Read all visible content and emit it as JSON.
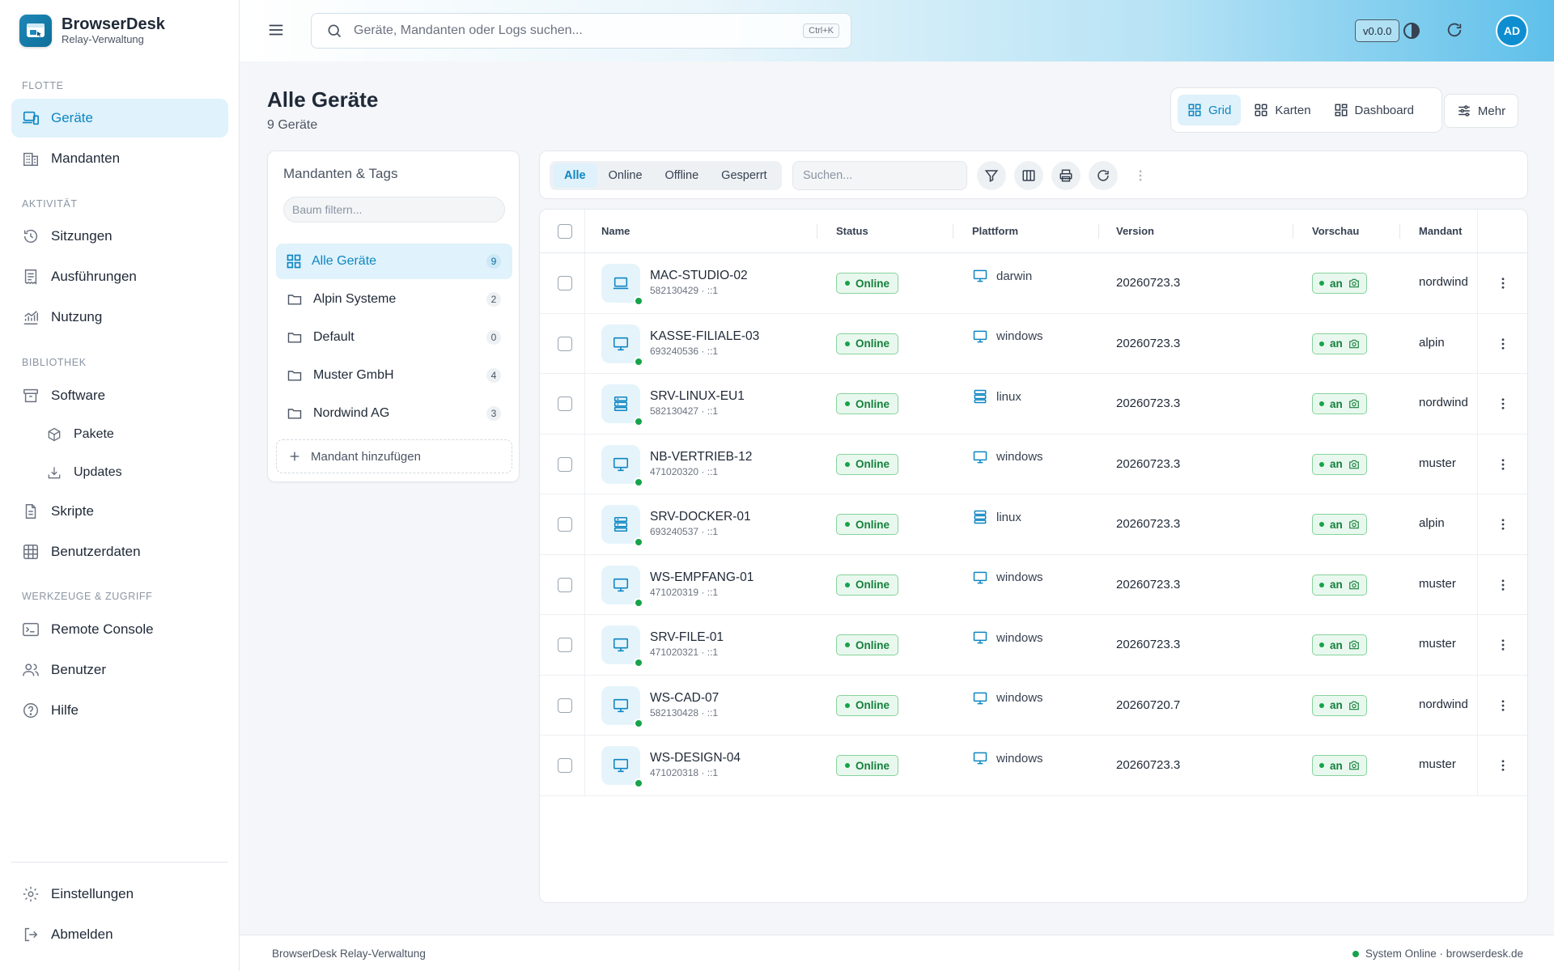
{
  "brand": {
    "title": "BrowserDesk",
    "subtitle": "Relay-Verwaltung"
  },
  "sidebar": {
    "sections": [
      "Flotte",
      "Aktivität",
      "Bibliothek",
      "Werkzeuge & Zugriff"
    ],
    "items": [
      {
        "label": "Geräte",
        "icon": "devices-icon",
        "active": true
      },
      {
        "label": "Mandanten",
        "icon": "building-icon"
      },
      {
        "label": "Sitzungen",
        "icon": "history-icon"
      },
      {
        "label": "Ausführungen",
        "icon": "receipt-icon"
      },
      {
        "label": "Nutzung",
        "icon": "chart-icon"
      },
      {
        "label": "Software",
        "icon": "archive-icon"
      },
      {
        "label": "Pakete",
        "icon": "package-icon"
      },
      {
        "label": "Updates",
        "icon": "download-icon"
      },
      {
        "label": "Skripte",
        "icon": "file-icon"
      },
      {
        "label": "Benutzerdaten",
        "icon": "grid-icon"
      },
      {
        "label": "Remote Console",
        "icon": "terminal-icon"
      },
      {
        "label": "Benutzer",
        "icon": "users-icon"
      },
      {
        "label": "Hilfe",
        "icon": "help-icon"
      }
    ],
    "bottom": [
      {
        "label": "Einstellungen",
        "icon": "gear-icon"
      },
      {
        "label": "Abmelden",
        "icon": "logout-icon"
      }
    ]
  },
  "header": {
    "search_placeholder": "Geräte, Mandanten oder Logs suchen...",
    "search_shortcut": "Ctrl+K",
    "version": "v0.0.0",
    "avatar_initials": "AD"
  },
  "page": {
    "title": "Alle Geräte",
    "subtitle": "9 Geräte"
  },
  "views": {
    "items": [
      {
        "label": "Grid",
        "active": true
      },
      {
        "label": "Karten"
      },
      {
        "label": "Dashboard"
      }
    ],
    "more_label": "Mehr"
  },
  "tree": {
    "title": "Mandanten & Tags",
    "filter_placeholder": "Baum filtern...",
    "items": [
      {
        "label": "Alle Geräte",
        "count": "9",
        "active": true
      },
      {
        "label": "Alpin Systeme",
        "count": "2"
      },
      {
        "label": "Default",
        "count": "0"
      },
      {
        "label": "Muster GmbH",
        "count": "4"
      },
      {
        "label": "Nordwind AG",
        "count": "3"
      }
    ],
    "add_label": "Mandant hinzufügen"
  },
  "toolbar": {
    "filters": [
      {
        "label": "Alle",
        "active": true
      },
      {
        "label": "Online"
      },
      {
        "label": "Offline"
      },
      {
        "label": "Gesperrt"
      }
    ],
    "search_placeholder": "Suchen..."
  },
  "table": {
    "columns": [
      "Name",
      "Status",
      "Plattform",
      "Version",
      "Vorschau",
      "Mandant"
    ],
    "rows": [
      {
        "name": "MAC-STUDIO-02",
        "id": "582130429 · ::1",
        "status": "Online",
        "platform": "darwin",
        "type": "laptop",
        "version": "20260723.3",
        "preview": "an",
        "mandant": "nordwind"
      },
      {
        "name": "KASSE-FILIALE-03",
        "id": "693240536 · ::1",
        "status": "Online",
        "platform": "windows",
        "type": "monitor",
        "version": "20260723.3",
        "preview": "an",
        "mandant": "alpin"
      },
      {
        "name": "SRV-LINUX-EU1",
        "id": "582130427 · ::1",
        "status": "Online",
        "platform": "linux",
        "type": "server",
        "version": "20260723.3",
        "preview": "an",
        "mandant": "nordwind"
      },
      {
        "name": "NB-VERTRIEB-12",
        "id": "471020320 · ::1",
        "status": "Online",
        "platform": "windows",
        "type": "monitor",
        "version": "20260723.3",
        "preview": "an",
        "mandant": "muster"
      },
      {
        "name": "SRV-DOCKER-01",
        "id": "693240537 · ::1",
        "status": "Online",
        "platform": "linux",
        "type": "server",
        "version": "20260723.3",
        "preview": "an",
        "mandant": "alpin"
      },
      {
        "name": "WS-EMPFANG-01",
        "id": "471020319 · ::1",
        "status": "Online",
        "platform": "windows",
        "type": "monitor",
        "version": "20260723.3",
        "preview": "an",
        "mandant": "muster"
      },
      {
        "name": "SRV-FILE-01",
        "id": "471020321 · ::1",
        "status": "Online",
        "platform": "windows",
        "type": "monitor",
        "version": "20260723.3",
        "preview": "an",
        "mandant": "muster"
      },
      {
        "name": "WS-CAD-07",
        "id": "582130428 · ::1",
        "status": "Online",
        "platform": "windows",
        "type": "monitor",
        "version": "20260720.7",
        "preview": "an",
        "mandant": "nordwind"
      },
      {
        "name": "WS-DESIGN-04",
        "id": "471020318 · ::1",
        "status": "Online",
        "platform": "windows",
        "type": "monitor",
        "version": "20260723.3",
        "preview": "an",
        "mandant": "muster"
      }
    ]
  },
  "footer": {
    "left": "BrowserDesk Relay-Verwaltung",
    "right": "System Online · browserdesk.de"
  },
  "colors": {
    "accent": "#0e86c2",
    "online": "#16a34a",
    "active_bg": "#e0f2fb"
  }
}
